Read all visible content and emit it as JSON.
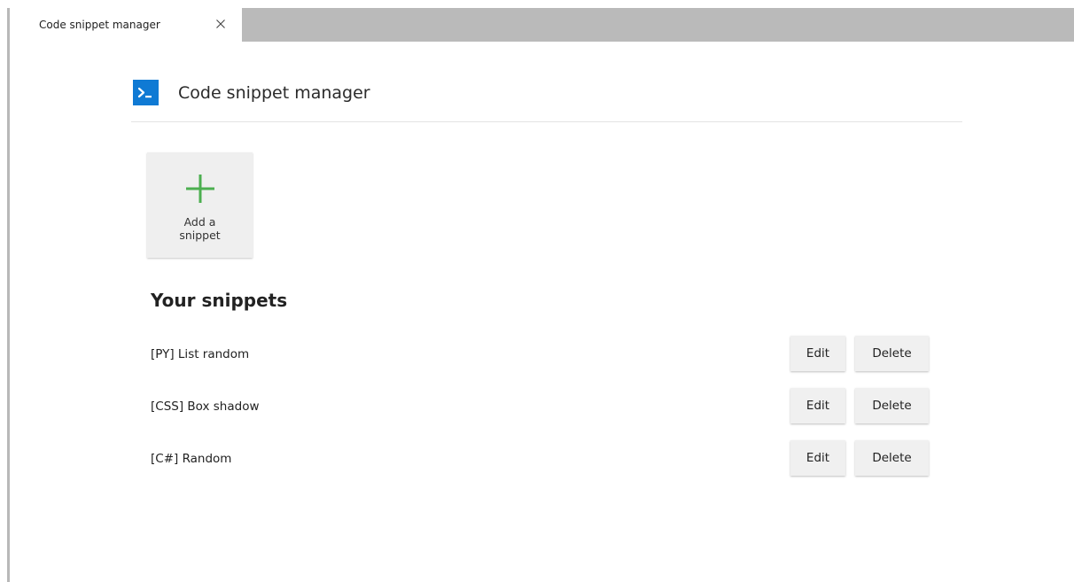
{
  "tab": {
    "title": "Code snippet manager"
  },
  "header": {
    "title": "Code snippet manager",
    "logo_icon": "terminal-icon",
    "logo_color": "#0f7ad4"
  },
  "add_tile": {
    "label": "Add a snippet",
    "icon": "plus-icon",
    "icon_color": "#4caf50"
  },
  "snippets": {
    "heading": "Your snippets",
    "items": [
      {
        "name": "[PY] List random",
        "edit_label": "Edit",
        "delete_label": "Delete"
      },
      {
        "name": "[CSS] Box shadow",
        "edit_label": "Edit",
        "delete_label": "Delete"
      },
      {
        "name": "[C#] Random",
        "edit_label": "Edit",
        "delete_label": "Delete"
      }
    ]
  }
}
